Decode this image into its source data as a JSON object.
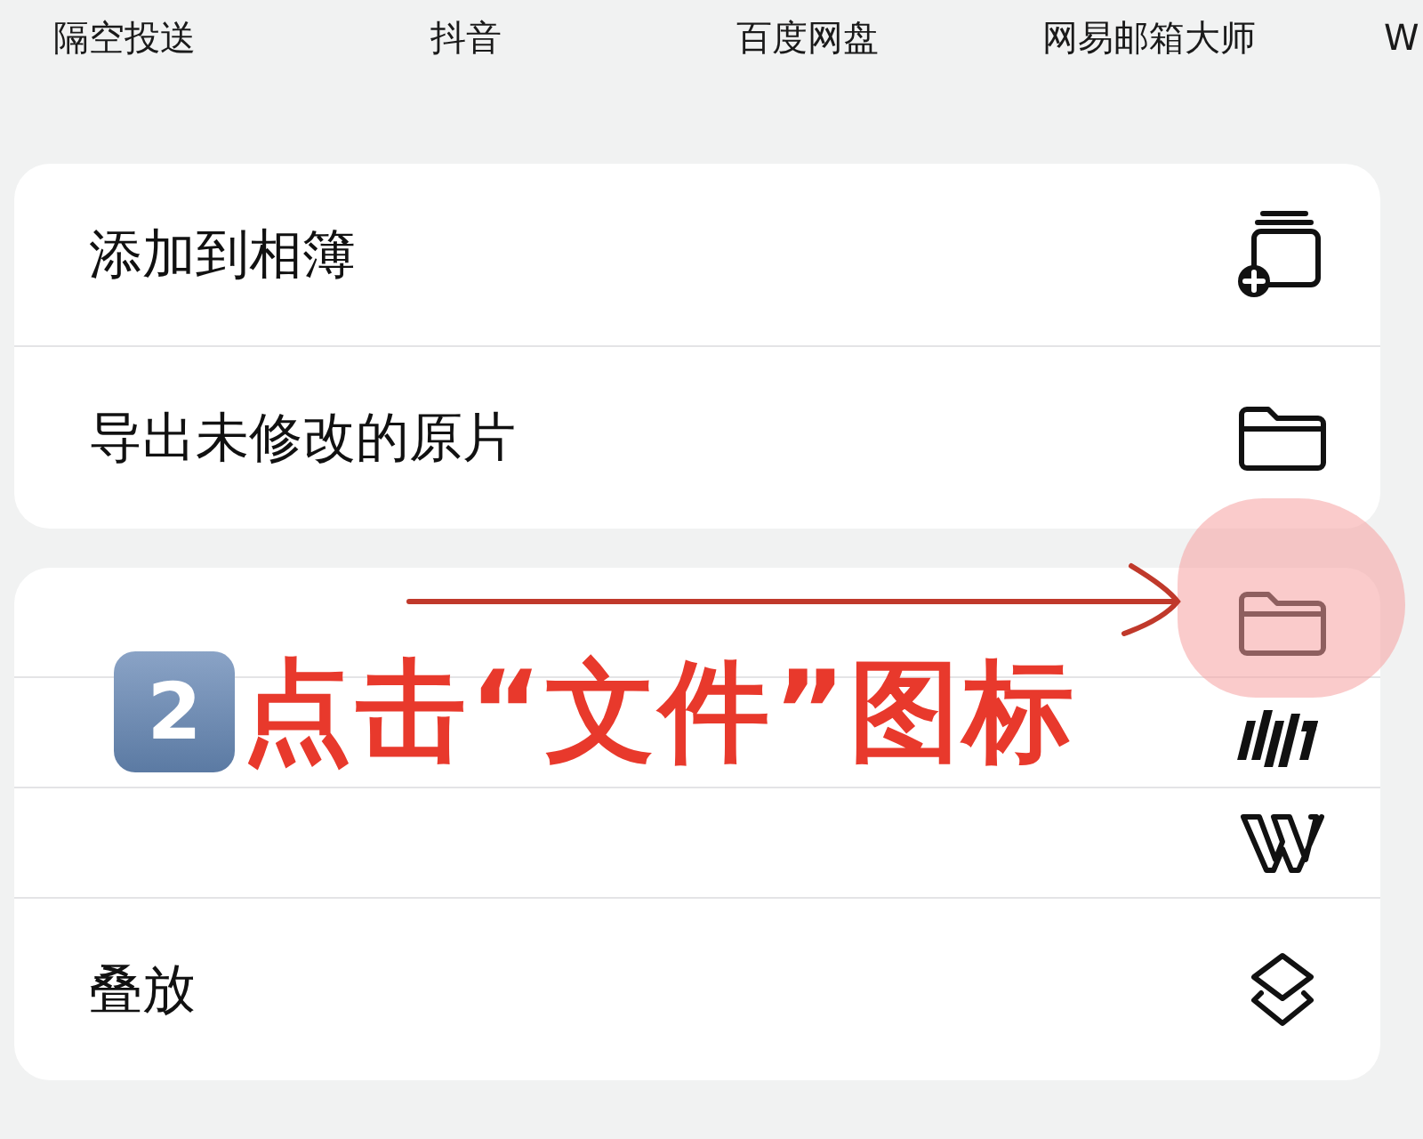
{
  "share_apps": [
    {
      "label": "隔空投送"
    },
    {
      "label": "抖音"
    },
    {
      "label": "百度网盘"
    },
    {
      "label": "网易邮箱大师"
    },
    {
      "label": "W"
    }
  ],
  "action_groups": [
    {
      "rows": [
        {
          "label": "添加到相簿",
          "kind": "album-add"
        },
        {
          "label": "导出未修改的原片",
          "kind": "folder"
        }
      ]
    },
    {
      "rows": [
        {
          "kind": "folder"
        },
        {
          "kind": "bars"
        },
        {
          "kind": "w-logo"
        },
        {
          "label": "叠放",
          "kind": "layers"
        }
      ]
    }
  ],
  "annotation": {
    "step": "2",
    "text": "点击“文件”图标"
  }
}
